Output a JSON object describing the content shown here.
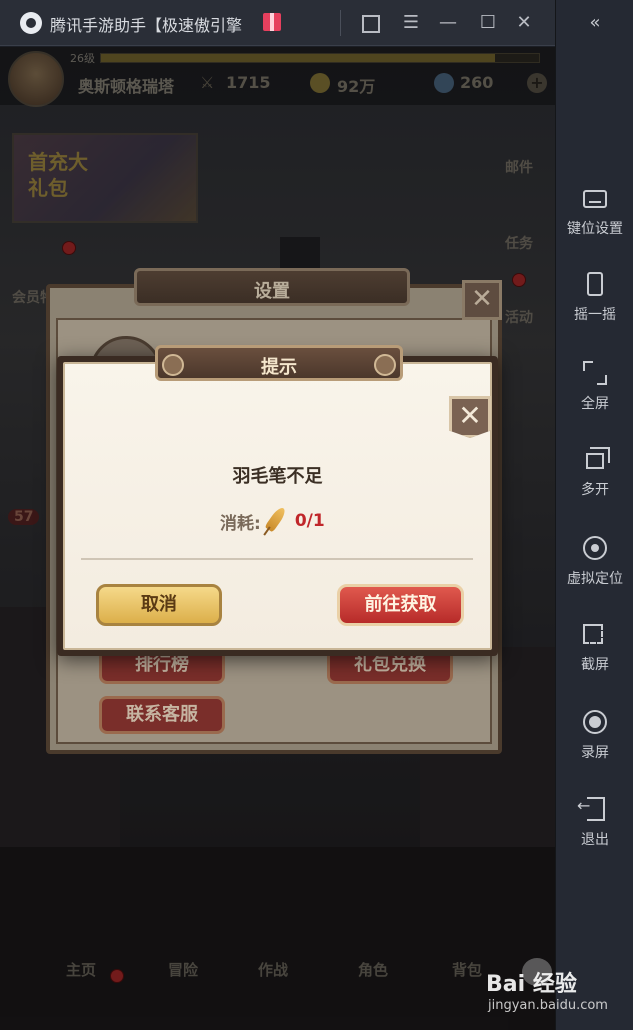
{
  "window": {
    "title": "腾讯手游助手【极速傲引擎"
  },
  "sidebar": {
    "collapse_icon": "«",
    "items": [
      {
        "label": "键位设置",
        "icon": "keyboard-icon"
      },
      {
        "label": "摇一摇",
        "icon": "phone-shake-icon"
      },
      {
        "label": "全屏",
        "icon": "fullscreen-icon"
      },
      {
        "label": "多开",
        "icon": "multi-window-icon"
      },
      {
        "label": "虚拟定位",
        "icon": "location-icon"
      },
      {
        "label": "截屏",
        "icon": "screenshot-icon"
      },
      {
        "label": "录屏",
        "icon": "record-icon"
      },
      {
        "label": "退出",
        "icon": "exit-icon"
      }
    ]
  },
  "hud": {
    "level": "26级",
    "player_name": "奥斯顿格瑞塔",
    "power": "1715",
    "gold": "92万",
    "gems": "260",
    "exp_fraction": 0.9
  },
  "game": {
    "promo_text": "首充大礼包",
    "vip_label": "会员特权",
    "mail_label": "邮件",
    "task_label": "任务",
    "event_label": "活动",
    "badge_count": "57",
    "nav": [
      "主页",
      "冒险",
      "作战",
      "角色",
      "背包"
    ]
  },
  "settings_panel": {
    "title": "设置",
    "buttons": [
      "排行榜",
      "礼包兑换",
      "联系客服"
    ]
  },
  "dialog": {
    "title": "提示",
    "message": "羽毛笔不足",
    "cost_label": "消耗:",
    "cost_value": "0/1",
    "cancel_label": "取消",
    "go_label": "前往获取"
  },
  "watermark": {
    "text": "Bai 经验",
    "url": "jingyan.baidu.com"
  }
}
